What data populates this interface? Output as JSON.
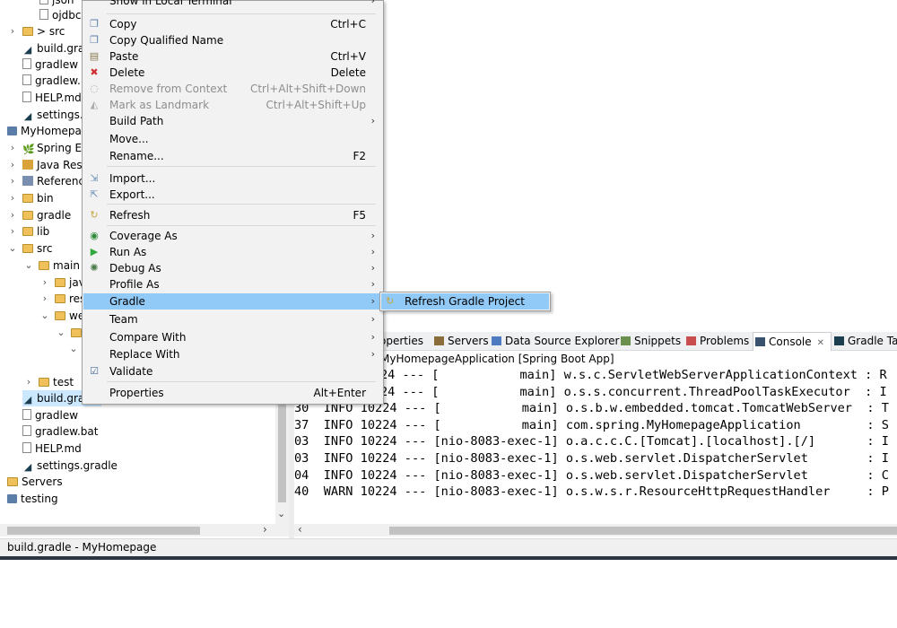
{
  "tree": {
    "rows": [
      {
        "label": "json",
        "indent": 2
      },
      {
        "label": "ojdbc",
        "indent": 2
      },
      {
        "label": "src",
        "indent": 1,
        "prefix": "> "
      },
      {
        "label": "build.gra",
        "indent": 1
      },
      {
        "label": "gradlew",
        "indent": 1
      },
      {
        "label": "gradlew.",
        "indent": 1
      },
      {
        "label": "HELP.md",
        "indent": 1
      },
      {
        "label": "settings.g",
        "indent": 1
      },
      {
        "label": "MyHomepa",
        "indent": 0
      },
      {
        "label": "Spring E",
        "indent": 1
      },
      {
        "label": "Java Reso",
        "indent": 1
      },
      {
        "label": "Referenc",
        "indent": 1
      },
      {
        "label": "bin",
        "indent": 1
      },
      {
        "label": "gradle",
        "indent": 1
      },
      {
        "label": "lib",
        "indent": 1
      },
      {
        "label": "src",
        "indent": 1
      },
      {
        "label": "main",
        "indent": 2
      },
      {
        "label": "jav",
        "indent": 3
      },
      {
        "label": "res",
        "indent": 3
      },
      {
        "label": "we",
        "indent": 3
      },
      {
        "label": "test",
        "indent": 2
      },
      {
        "label": "build.gra",
        "indent": 1
      },
      {
        "label": "gradlew",
        "indent": 1
      },
      {
        "label": "gradlew.bat",
        "indent": 1
      },
      {
        "label": "HELP.md",
        "indent": 1
      },
      {
        "label": "settings.gradle",
        "indent": 1
      },
      {
        "label": "Servers",
        "indent": 0
      },
      {
        "label": "testing",
        "indent": 0
      }
    ]
  },
  "context_menu": {
    "top_label": "Show in Local Terminal",
    "items": [
      {
        "label": "Copy",
        "accel": "Ctrl+C",
        "icon": "copy-icon"
      },
      {
        "label": "Copy Qualified Name",
        "accel": "",
        "icon": "copy-qualified-icon"
      },
      {
        "label": "Paste",
        "accel": "Ctrl+V",
        "icon": "paste-icon"
      },
      {
        "label": "Delete",
        "accel": "Delete",
        "icon": "delete-icon"
      },
      {
        "label": "Remove from Context",
        "accel": "Ctrl+Alt+Shift+Down",
        "icon": "remove-context-icon"
      },
      {
        "label": "Mark as Landmark",
        "accel": "Ctrl+Alt+Shift+Up",
        "icon": "landmark-icon"
      },
      {
        "label": "Build Path",
        "accel": "",
        "icon": ""
      },
      {
        "label": "Move...",
        "accel": "",
        "icon": ""
      },
      {
        "label": "Rename...",
        "accel": "F2",
        "icon": ""
      },
      {
        "label": "Import...",
        "accel": "",
        "icon": "import-icon"
      },
      {
        "label": "Export...",
        "accel": "",
        "icon": "export-icon"
      },
      {
        "label": "Refresh",
        "accel": "F5",
        "icon": "refresh-icon"
      },
      {
        "label": "Coverage As",
        "accel": "",
        "icon": "coverage-icon"
      },
      {
        "label": "Run As",
        "accel": "",
        "icon": "run-icon"
      },
      {
        "label": "Debug As",
        "accel": "",
        "icon": "debug-icon"
      },
      {
        "label": "Profile As",
        "accel": "",
        "icon": ""
      },
      {
        "label": "Gradle",
        "accel": "",
        "icon": ""
      },
      {
        "label": "Team",
        "accel": "",
        "icon": ""
      },
      {
        "label": "Compare With",
        "accel": "",
        "icon": ""
      },
      {
        "label": "Replace With",
        "accel": "",
        "icon": ""
      },
      {
        "label": "Validate",
        "accel": "",
        "icon": "validate-check-icon"
      },
      {
        "label": "Properties",
        "accel": "Alt+Enter",
        "icon": ""
      }
    ],
    "submenu_item": "Refresh Gradle Project"
  },
  "bottom_panel": {
    "tabs": [
      "operties",
      "Servers",
      "Data Source Explorer",
      "Snippets",
      "Problems",
      "Console",
      "Gradle Ta"
    ],
    "console_title": "MyHomepageApplication [Spring Boot App]",
    "lines": [
      "24 --- [           main] w.s.c.ServletWebServerApplicationContext : R",
      "24 --- [           main] o.s.s.concurrent.ThreadPoolTaskExecutor  : I",
      "30  INFO 10224 --- [           main] o.s.b.w.embedded.tomcat.TomcatWebServer  : T",
      "37  INFO 10224 --- [           main] com.spring.MyHomepageApplication         : S",
      "03  INFO 10224 --- [nio-8083-exec-1] o.a.c.c.C.[Tomcat].[localhost].[/]       : I",
      "03  INFO 10224 --- [nio-8083-exec-1] o.s.web.servlet.DispatcherServlet        : I",
      "04  INFO 10224 --- [nio-8083-exec-1] o.s.web.servlet.DispatcherServlet        : C",
      "40  WARN 10224 --- [nio-8083-exec-1] o.s.w.s.r.ResourceHttpRequestHandler     : P"
    ]
  },
  "status": {
    "text": "build.gradle - MyHomepage"
  }
}
